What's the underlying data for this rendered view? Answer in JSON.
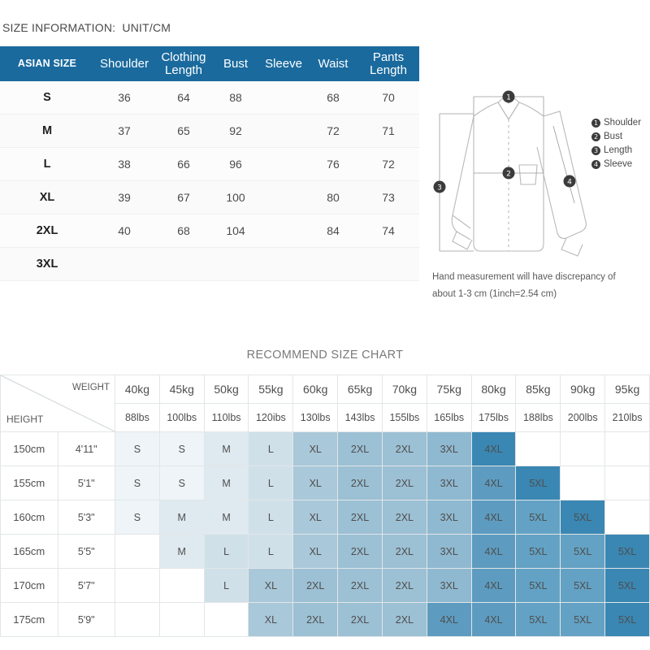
{
  "header": {
    "size_info_title": "SIZE INFORMATION:  UNIT/CM"
  },
  "size_table": {
    "columns": [
      "ASIAN SIZE",
      "Shoulder",
      "Clothing Length",
      "Bust",
      "Sleeve",
      "Waist",
      "Pants Length"
    ],
    "header_bg": "#1a6a9e",
    "rows": [
      {
        "size": "S",
        "shoulder": "36",
        "clothing_length": "64",
        "bust": "88",
        "sleeve": "",
        "waist": "68",
        "pants_length": "70"
      },
      {
        "size": "M",
        "shoulder": "37",
        "clothing_length": "65",
        "bust": "92",
        "sleeve": "",
        "waist": "72",
        "pants_length": "71"
      },
      {
        "size": "L",
        "shoulder": "38",
        "clothing_length": "66",
        "bust": "96",
        "sleeve": "",
        "waist": "76",
        "pants_length": "72"
      },
      {
        "size": "XL",
        "shoulder": "39",
        "clothing_length": "67",
        "bust": "100",
        "sleeve": "",
        "waist": "80",
        "pants_length": "73"
      },
      {
        "size": "2XL",
        "shoulder": "40",
        "clothing_length": "68",
        "bust": "104",
        "sleeve": "",
        "waist": "84",
        "pants_length": "74"
      },
      {
        "size": "3XL",
        "shoulder": "",
        "clothing_length": "",
        "bust": "",
        "sleeve": "",
        "waist": "",
        "pants_length": ""
      }
    ]
  },
  "diagram": {
    "legend": [
      {
        "num": "1",
        "label": "Shoulder"
      },
      {
        "num": "2",
        "label": "Bust"
      },
      {
        "num": "3",
        "label": "Length"
      },
      {
        "num": "4",
        "label": "Sleeve"
      }
    ],
    "callouts": [
      "1",
      "2",
      "3",
      "4"
    ],
    "disclaimer_line1": "Hand measurement will have discrepancy of",
    "disclaimer_line2": "about 1-3 cm  (1inch=2.54 cm)"
  },
  "recommend": {
    "title": "RECOMMEND SIZE CHART",
    "corner_weight_label": "WEIGHT",
    "corner_height_label": "HEIGHT",
    "weights_kg": [
      "40kg",
      "45kg",
      "50kg",
      "55kg",
      "60kg",
      "65kg",
      "70kg",
      "75kg",
      "80kg",
      "85kg",
      "90kg",
      "95kg"
    ],
    "weights_lbs": [
      "88lbs",
      "100lbs",
      "110lbs",
      "120ibs",
      "130lbs",
      "143lbs",
      "155lbs",
      "165lbs",
      "175lbs",
      "188lbs",
      "200lbs",
      "210lbs"
    ],
    "heights_cm": [
      "150cm",
      "155cm",
      "160cm",
      "165cm",
      "170cm",
      "175cm"
    ],
    "heights_ft": [
      "4'11\"",
      "5'1\"",
      "5'3\"",
      "5'5\"",
      "5'7\"",
      "5'9\""
    ],
    "grid": [
      [
        "S",
        "S",
        "M",
        "L",
        "XL",
        "2XL",
        "2XL",
        "3XL",
        "4XL",
        "",
        "",
        ""
      ],
      [
        "S",
        "S",
        "M",
        "L",
        "XL",
        "2XL",
        "2XL",
        "3XL",
        "4XL",
        "5XL",
        "",
        ""
      ],
      [
        "S",
        "M",
        "M",
        "L",
        "XL",
        "2XL",
        "2XL",
        "3XL",
        "4XL",
        "5XL",
        "5XL",
        ""
      ],
      [
        "",
        "M",
        "L",
        "L",
        "XL",
        "2XL",
        "2XL",
        "3XL",
        "4XL",
        "5XL",
        "5XL",
        "5XL"
      ],
      [
        "",
        "",
        "L",
        "XL",
        "2XL",
        "2XL",
        "2XL",
        "3XL",
        "4XL",
        "5XL",
        "5XL",
        "5XL"
      ],
      [
        "",
        "",
        "",
        "XL",
        "2XL",
        "2XL",
        "2XL",
        "4XL",
        "4XL",
        "5XL",
        "5XL",
        "5XL"
      ]
    ],
    "size_colors": {
      "S": "#eef4f7",
      "M": "#dfeaf0",
      "L": "#cfe0e9",
      "XL": "#a9c8d9",
      "2XL": "#9cc0d4",
      "3XL": "#8fb9d0",
      "4XL": "#5d9cc0",
      "5XL": "#63a2c4",
      "empty": "#ffffff"
    }
  }
}
